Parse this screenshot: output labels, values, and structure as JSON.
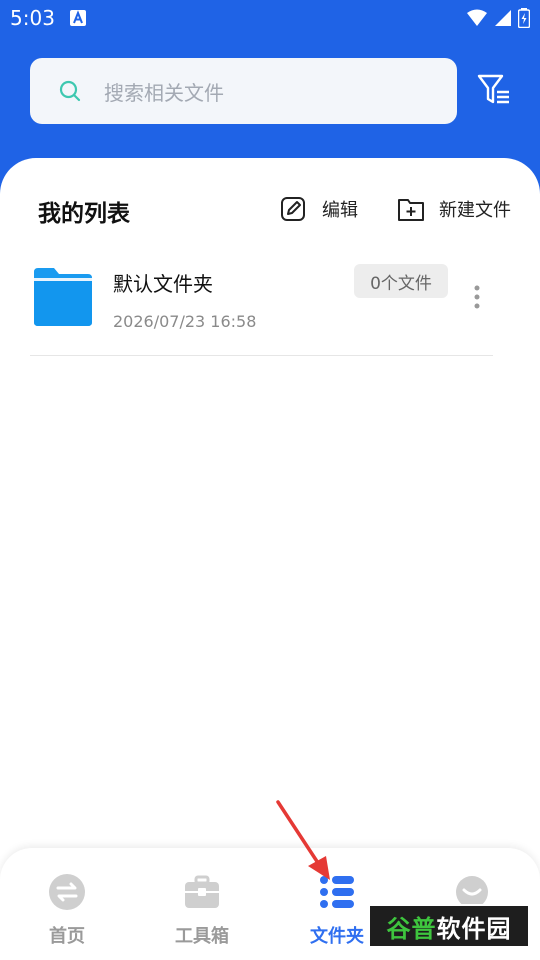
{
  "status_bar": {
    "time": "5:03"
  },
  "search": {
    "placeholder": "搜索相关文件"
  },
  "list": {
    "title": "我的列表",
    "edit_label": "编辑",
    "new_file_label": "新建文件",
    "folders": [
      {
        "name": "默认文件夹",
        "date": "2026/07/23 16:58",
        "count": "0个文件"
      }
    ]
  },
  "bottom_nav": [
    {
      "label": "首页",
      "active": false
    },
    {
      "label": "工具箱",
      "active": false
    },
    {
      "label": "文件夹",
      "active": true
    }
  ],
  "watermark": {
    "part1": "谷普",
    "part2": "软件园"
  },
  "colors": {
    "header_blue": "#1f63e6",
    "active_blue": "#2f6ff0",
    "folder_blue": "#1a9bf0",
    "annotation_red": "#e53935"
  }
}
